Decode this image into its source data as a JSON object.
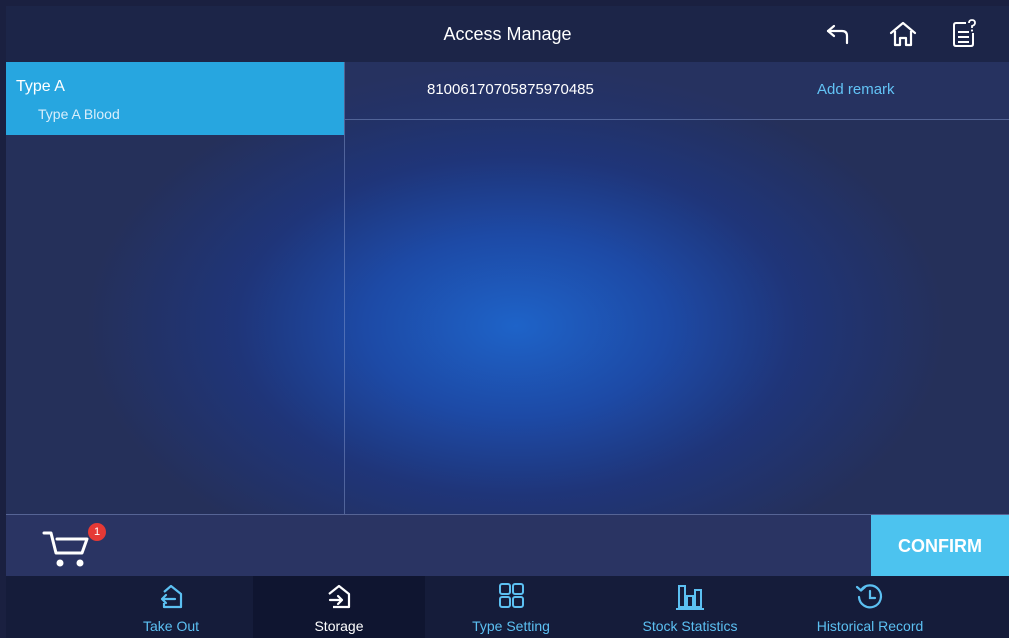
{
  "header": {
    "title": "Access Manage"
  },
  "icons": {
    "back": "back-arrow-icon",
    "home": "home-icon",
    "help": "help-document-icon",
    "cart": "cart-icon"
  },
  "types": [
    {
      "name": "Type A",
      "description": "Type A Blood"
    }
  ],
  "items": [
    {
      "code": "81006170705875970485",
      "action": "Add remark"
    }
  ],
  "cart": {
    "count": "1"
  },
  "confirm_label": "CONFIRM",
  "nav": [
    {
      "label": "Take Out",
      "icon": "take-out-icon"
    },
    {
      "label": "Storage",
      "icon": "storage-icon",
      "active": true
    },
    {
      "label": "Type Setting",
      "icon": "grid-icon"
    },
    {
      "label": "Stock Statistics",
      "icon": "bar-chart-icon"
    },
    {
      "label": "Historical Record",
      "icon": "history-clock-icon"
    }
  ],
  "colors": {
    "accent": "#27a6e0",
    "confirm": "#4cc3ef",
    "link": "#62c3f5",
    "badge": "#e53935"
  }
}
